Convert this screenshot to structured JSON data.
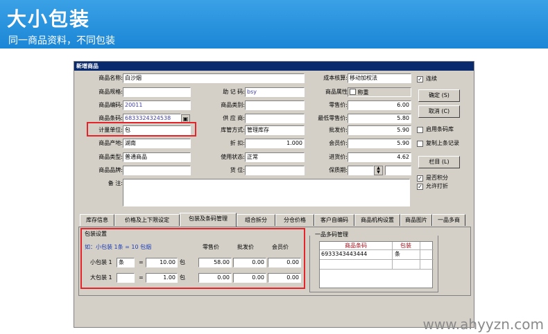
{
  "banner": {
    "title": "大小包装",
    "subtitle": "同一商品资料，不同包装"
  },
  "window": {
    "title": "新增商品"
  },
  "form": {
    "name_label": "商品名称:",
    "name_value": "白沙烟",
    "spec_label": "商品规格:",
    "spec_value": "",
    "code_label": "商品编码:",
    "code_value": "20011",
    "barcode_label": "商品条码:",
    "barcode_value": "6833324324538",
    "unit_label": "计量单位:",
    "unit_value": "包",
    "origin_label": "商品产地:",
    "origin_value": "湖南",
    "type_label": "商品类型:",
    "type_value": "普通商品",
    "brand_label": "商品品牌:",
    "brand_value": "",
    "mnemonic_label": "助 记 码:",
    "mnemonic_value": "bsy",
    "category_label": "商品类别:",
    "category_value": "",
    "supplier_label": "供 应 商:",
    "supplier_value": "",
    "stock_mode_label": "库管方式:",
    "stock_mode_value": "管理库存",
    "discount_label": "折     扣:",
    "discount_value": "1.000",
    "status_label": "使用状态:",
    "status_value": "正常",
    "location_label": "货     位:",
    "location_value": "",
    "cost_label": "成本核算:",
    "cost_value": "移动加权法",
    "attr_label": "商品属性",
    "attr_weigh": "称重",
    "retail_label": "零售价:",
    "retail_value": "6.00",
    "min_retail_label": "最低零售价:",
    "min_retail_value": "5.80",
    "wholesale_label": "批发价:",
    "wholesale_value": "5.90",
    "member_label": "会员价:",
    "member_value": "5.90",
    "purchase_label": "进货价:",
    "purchase_value": "4.62",
    "shelf_label": "保质期:",
    "shelf_value": "",
    "note_label": "备   注:",
    "note_value": ""
  },
  "checks": {
    "continuous": "连续",
    "enable_barcode": "启用条码库",
    "copy_last": "复制上条记录",
    "points": "是否积分",
    "allow_discount": "允许打折"
  },
  "buttons": {
    "ok": "确定 (S)",
    "cancel": "取消 (C)",
    "column": "栏目 (L)"
  },
  "tabs": [
    "库存信息",
    "价格及上下限设定",
    "包装及条码管理",
    "组合拆分",
    "分仓价格",
    "客户自编码",
    "商品机构设置",
    "商品图片",
    "一品多商"
  ],
  "package": {
    "title": "包装设置",
    "example": "如：小包装 1条 = 10 包烟",
    "col_retail": "零售价",
    "col_wholesale": "批发价",
    "col_member": "会员价",
    "small_label": "小包装 1",
    "small_unit": "条",
    "small_qty": "10.00",
    "small_base": "包",
    "small_retail": "58.00",
    "small_wholesale": "0.00",
    "small_member": "0.00",
    "large_label": "大包装 1",
    "large_unit": "",
    "large_qty": "1.00",
    "large_base": "包",
    "large_retail": "0.00",
    "large_wholesale": "0.00",
    "large_member": "0.00",
    "eq": "="
  },
  "multicode": {
    "title": "一品多码管理",
    "col_barcode": "商品条码",
    "col_pack": "包装",
    "rows": [
      {
        "barcode": "6933343443444",
        "pack": "条"
      }
    ]
  },
  "watermark": "www.ahyyzn.com",
  "colors": {
    "banner": "#1b86d6",
    "highlight": "#e3242b",
    "window_title": "#0a2a6e"
  }
}
